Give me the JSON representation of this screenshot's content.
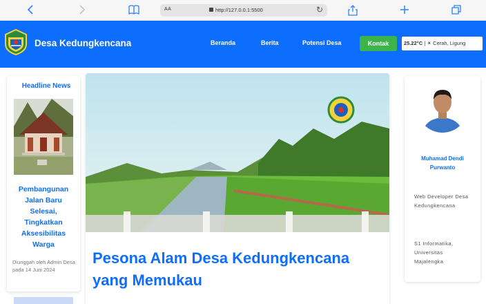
{
  "browser": {
    "url": "http://127.0.0.1:5500",
    "text_size_label": "AA"
  },
  "header": {
    "brand": "Desa Kedungkencana",
    "nav": [
      "Beranda",
      "Berita",
      "Potensi Desa"
    ],
    "contact_label": "Kontak",
    "weather": {
      "temperature": "25.22°C",
      "separator": "|",
      "condition": "Cerah,",
      "location": "Ligung"
    }
  },
  "sidebar": {
    "title": "Headline News",
    "news": {
      "title": "Pembangunan Jalan Baru Selesai, Tingkatkan Aksesibilitas Warga",
      "meta": "Diunggah oleh Admin Desa pada 14 Juni 2024"
    }
  },
  "article": {
    "title": "Pesona Alam Desa Kedungkencana yang Memukau"
  },
  "profile": {
    "name": "Muhamad Dendi Purwanto",
    "role": "Web Developer Desa Kedungkencana",
    "education": "S1 Informatika, Universitas Majalengka"
  },
  "colors": {
    "primary": "#0d6efd",
    "accent_green": "#3cb44b",
    "browser_icon": "#2f80ff"
  },
  "icons": [
    "back-icon",
    "forward-icon",
    "book-icon",
    "lock-icon",
    "reload-icon",
    "share-icon",
    "plus-icon",
    "tabs-icon",
    "sun-icon"
  ]
}
